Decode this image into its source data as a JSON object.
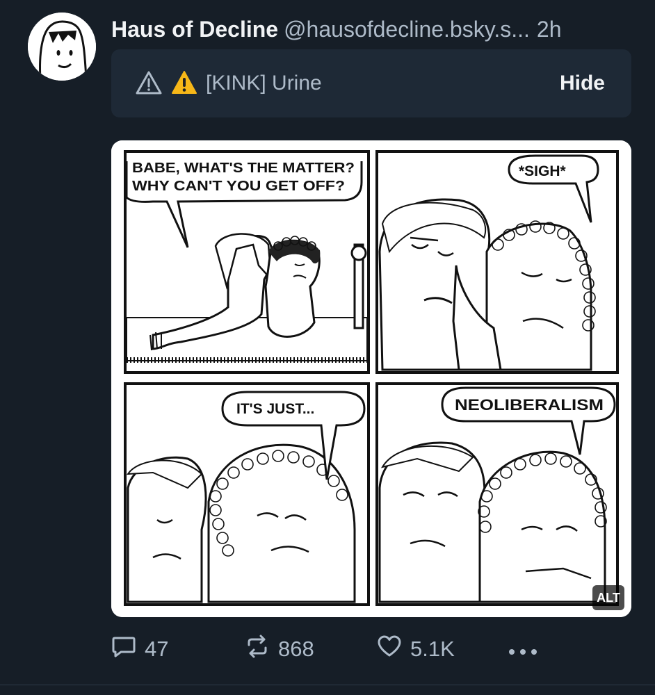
{
  "post": {
    "author_name": "Haus of Decline",
    "handle": "@hausofdecline.bsky.s...",
    "time": "2h"
  },
  "content_warning": {
    "emoji": "⚠️",
    "label": "[KINK] Urine",
    "hide_label": "Hide"
  },
  "comic": {
    "panels": [
      {
        "speech": [
          "BABE, WHAT'S THE MATTER?",
          "WHY CAN'T YOU GET OFF?"
        ]
      },
      {
        "speech": [
          "*SIGH*"
        ]
      },
      {
        "speech": [
          "IT'S JUST..."
        ]
      },
      {
        "speech": [
          "NEOLIBERALISM"
        ]
      }
    ],
    "alt_badge": "ALT"
  },
  "actions": {
    "replies": "47",
    "reposts": "868",
    "likes": "5.1K"
  },
  "icons": [
    "avatar",
    "warning-outline-icon",
    "warning-emoji-icon",
    "reply-icon",
    "repost-icon",
    "like-icon",
    "more-icon"
  ],
  "colors": {
    "background": "#161e27",
    "warning_box": "#1e2936",
    "muted_text": "#aebbc9"
  }
}
